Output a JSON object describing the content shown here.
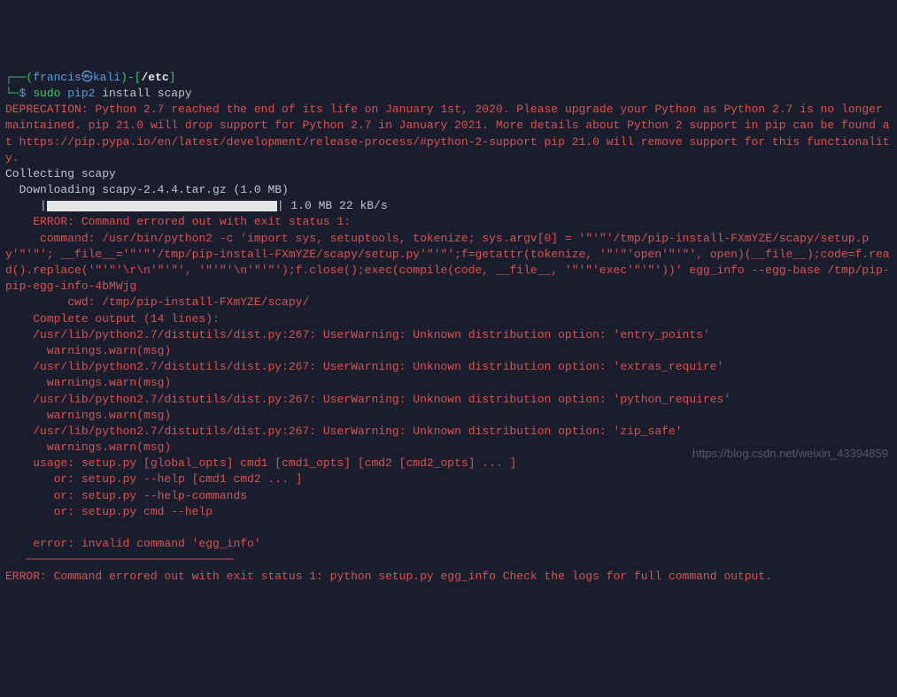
{
  "prompt": {
    "box_open": "┌──",
    "paren_open": "(",
    "user": "francis",
    "skull": "㉿",
    "host": "kali",
    "paren_close": ")",
    "dash_open": "-[",
    "cwd": "/etc",
    "bracket_close": "]",
    "box_continue": "└─",
    "dollar": "$ ",
    "sudo": "sudo",
    "cmd": " pip2",
    "args": " install scapy"
  },
  "deprecation": "DEPRECATION: Python 2.7 reached the end of its life on January 1st, 2020. Please upgrade your Python as Python 2.7 is no longer maintained. pip 21.0 will drop support for Python 2.7 in January 2021. More details about Python 2 support in pip can be found at https://pip.pypa.io/en/latest/development/release-process/#python-2-support pip 21.0 will remove support for this functionality.",
  "collecting": "Collecting scapy",
  "downloading": "  Downloading scapy-2.4.4.tar.gz (1.0 MB)",
  "progress_prefix": "     |",
  "progress_suffix": "| 1.0 MB 22 kB/s",
  "error_header": "    ERROR: Command errored out with exit status 1:",
  "error_lines": {
    "l0": "     command: /usr/bin/python2 -c 'import sys, setuptools, tokenize; sys.argv[0] = '\"'\"'/tmp/pip-install-FXmYZE/scapy/setup.py'\"'\"'; __file__='\"'\"'/tmp/pip-install-FXmYZE/scapy/setup.py'\"'\"';f=getattr(tokenize, '\"'\"'open'\"'\"', open)(__file__);code=f.read().replace('\"'\"'\\r\\n'\"'\"', '\"'\"'\\n'\"'\"');f.close();exec(compile(code, __file__, '\"'\"'exec'\"'\"'))' egg_info --egg-base /tmp/pip-pip-egg-info-4bMWjg",
    "l1": "         cwd: /tmp/pip-install-FXmYZE/scapy/",
    "l2": "    Complete output (14 lines):",
    "l3": "    /usr/lib/python2.7/distutils/dist.py:267: UserWarning: Unknown distribution option: 'entry_points'",
    "l4": "      warnings.warn(msg)",
    "l5": "    /usr/lib/python2.7/distutils/dist.py:267: UserWarning: Unknown distribution option: 'extras_require'",
    "l6": "      warnings.warn(msg)",
    "l7": "    /usr/lib/python2.7/distutils/dist.py:267: UserWarning: Unknown distribution option: 'python_requires'",
    "l8": "      warnings.warn(msg)",
    "l9": "    /usr/lib/python2.7/distutils/dist.py:267: UserWarning: Unknown distribution option: 'zip_safe'",
    "l10": "      warnings.warn(msg)",
    "l11": "    usage: setup.py [global_opts] cmd1 [cmd1_opts] [cmd2 [cmd2_opts] ... ]",
    "l12": "       or: setup.py --help [cmd1 cmd2 ... ]",
    "l13": "       or: setup.py --help-commands",
    "l14": "       or: setup.py cmd --help",
    "l15": "    ",
    "l16": "    error: invalid command 'egg_info'"
  },
  "divider": "    ────────────────────────────────────────",
  "final_error": "ERROR: Command errored out with exit status 1: python setup.py egg_info Check the logs for full command output.",
  "watermark": "https://blog.csdn.net/weixin_43394859"
}
